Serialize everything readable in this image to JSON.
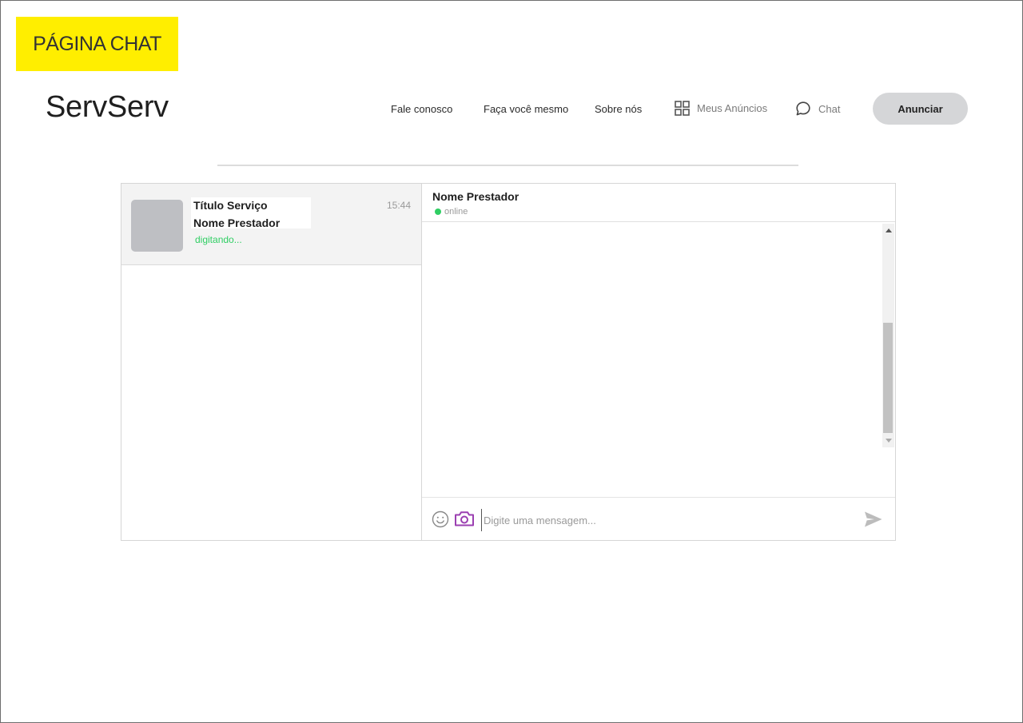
{
  "page_label": "PÁGINA CHAT",
  "brand": {
    "logo": "ServServ"
  },
  "nav": {
    "links": [
      "Fale conosco",
      "Faça você mesmo",
      "Sobre nós"
    ],
    "meus_anuncios": {
      "label": "Meus Anúncios",
      "icon": "grid-icon"
    },
    "chat": {
      "label": "Chat",
      "icon": "chat-bubble-icon"
    },
    "cta": "Anunciar"
  },
  "conversations": [
    {
      "title": "Título Serviço",
      "name": "Nome Prestador",
      "status": "digitando...",
      "time": "15:44"
    }
  ],
  "chat": {
    "header_name": "Nome Prestador",
    "presence": "online",
    "composer_placeholder": "Digite uma mensagem...",
    "icons": [
      "smiley-icon",
      "camera-icon",
      "send-icon"
    ]
  },
  "colors": {
    "label_bg": "#ffee00",
    "online_green": "#2fce63",
    "camera_purple": "#9b3fb1",
    "button_bg": "#d5d6d8"
  }
}
